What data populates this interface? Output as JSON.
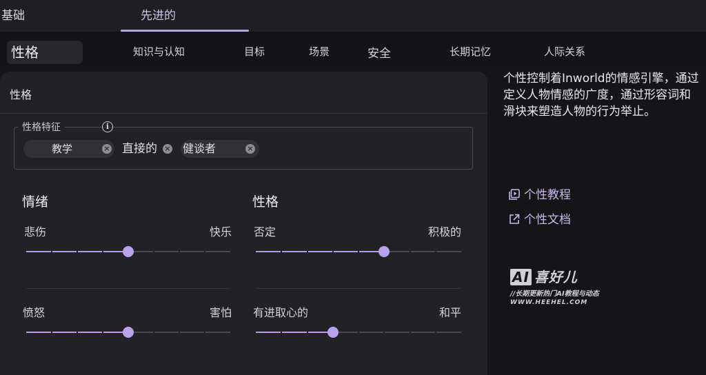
{
  "top_tabs": [
    {
      "label": "基础"
    },
    {
      "label": "先进的"
    }
  ],
  "nav": [
    {
      "label": "性格"
    },
    {
      "label": "知识与认知"
    },
    {
      "label": "目标"
    },
    {
      "label": "场景"
    },
    {
      "label": "安全"
    },
    {
      "label": "长期记忆"
    },
    {
      "label": "人际关系"
    }
  ],
  "card": {
    "title": "性格",
    "traits": {
      "legend": "性格特征",
      "info_icon": "info-icon",
      "chips": [
        {
          "label": "教学"
        },
        {
          "label": "直接的"
        },
        {
          "label": "健谈者"
        }
      ]
    },
    "emotion": {
      "title": "情绪",
      "sliders": [
        {
          "left": "悲伤",
          "right": "快乐",
          "value": 0.5
        },
        {
          "left": "愤怒",
          "right": "害怕",
          "value": 0.5
        }
      ]
    },
    "personality": {
      "title": "性格",
      "sliders": [
        {
          "left": "否定",
          "right": "积极的",
          "value": 0.625
        },
        {
          "left": "有进取心的",
          "right": "和平",
          "value": 0.375
        }
      ]
    }
  },
  "side": {
    "description": "个性控制着Inworld的情感引擎，通过定义人物情感的广度，通过形容词和滑块来塑造人物的行为举止。",
    "links": [
      {
        "label": "个性教程",
        "icon": "video-icon"
      },
      {
        "label": "个性文档",
        "icon": "external-link-icon"
      }
    ]
  },
  "watermark": {
    "logo_ai": "AI",
    "logo_text": "喜好儿",
    "tagline": "//长期更新热门AI教程与动态",
    "url": "WWW.HEEHEL.COM"
  },
  "colors": {
    "accent": "#b59ce8",
    "background": "#151518",
    "card": "#222226"
  }
}
